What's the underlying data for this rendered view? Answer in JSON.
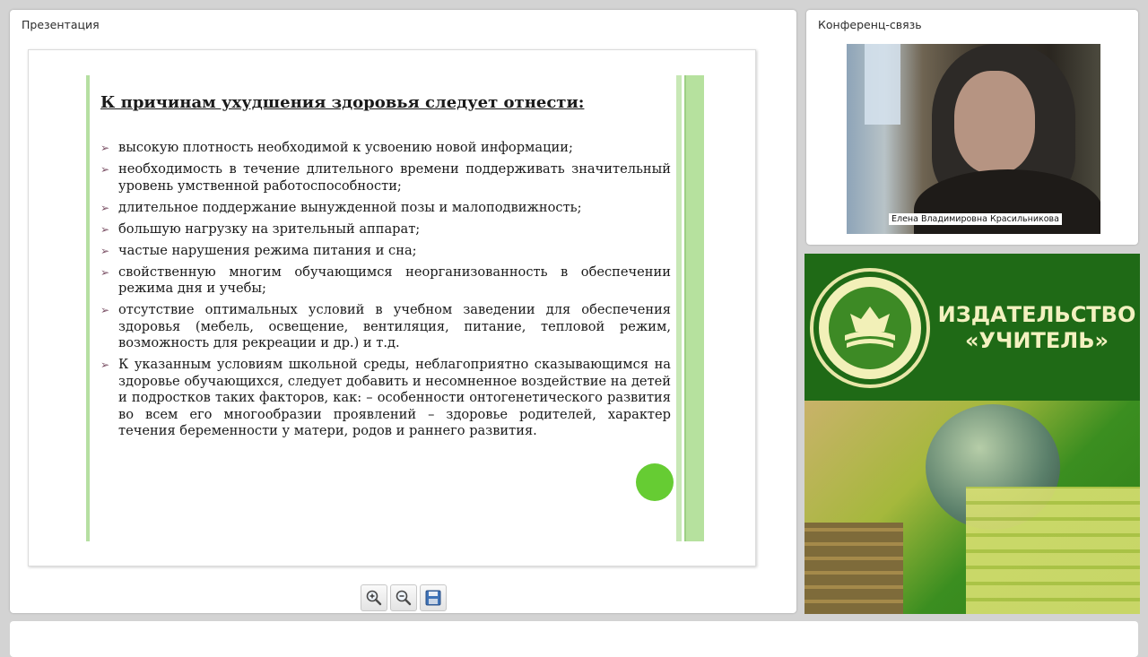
{
  "presentation": {
    "title": "Презентация",
    "slide": {
      "heading": "К причинам ухудшения здоровья следует отнести:",
      "bullets": [
        "высокую плотность необходимой к усвоению новой информации;",
        "необходимость в течение длительного времени поддерживать значительный уровень умственной работоспособности;",
        "длительное поддержание вынужденной позы и малоподвижность;",
        "большую нагрузку на зрительный аппарат;",
        "частые нарушения режима питания и сна;",
        "свойственную многим обучающимся неорганизованность в обеспечении режима дня и учебы;",
        "отсутствие оптимальных условий в учебном заведении для обеспечения здоровья (мебель, освещение, вентиляция, питание, тепловой режим, возможность для рекреации и др.) и т.д.",
        "К указанным условиям школьной среды, неблагоприятно сказывающимся на здоровье обучающихся, следует добавить и несомненное воздействие на детей и подростков таких факторов, как: – особенности онтогенетического развития во всем его многообразии проявлений – здоровье родителей, характер течения беременности у матери, родов и раннего развития."
      ]
    },
    "toolbar": {
      "zoom_in_icon": "zoom-in-icon",
      "zoom_out_icon": "zoom-out-icon",
      "save_icon": "save-icon"
    }
  },
  "conference": {
    "title": "Конференц-связь",
    "participant_name": "Елена Владимировна Красильникова"
  },
  "ad": {
    "line1": "ИЗДАТЕЛЬСТВО",
    "line2": "«УЧИТЕЛЬ»"
  },
  "colors": {
    "accent_green": "#66cc33",
    "brand_green": "#1f6a16",
    "slide_bar_green": "#b6e19e"
  }
}
